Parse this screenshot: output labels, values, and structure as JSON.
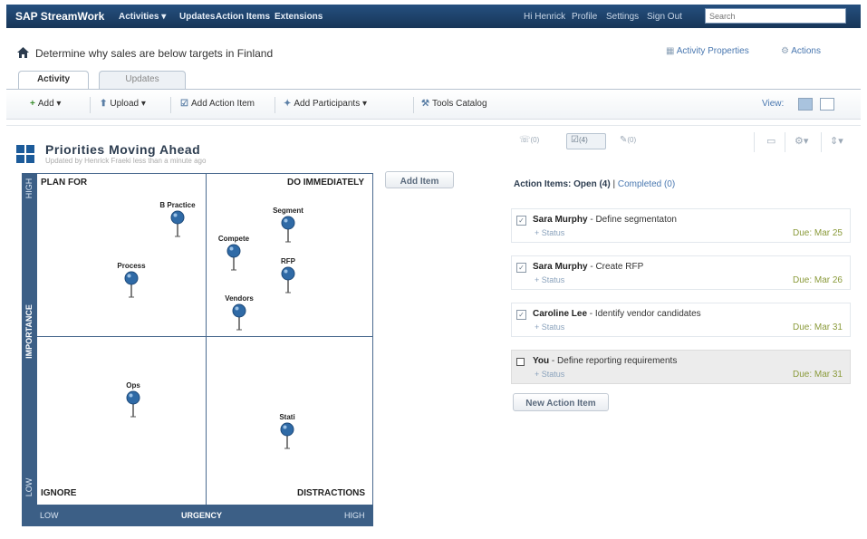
{
  "topnav": {
    "logo": "SAP StreamWork",
    "items": [
      "Activities ▾",
      "Updates",
      "Action Items",
      "Extensions"
    ],
    "right_links": [
      "Hi Henrick",
      "Profile",
      "Settings",
      "Sign Out"
    ],
    "search_placeholder": "Search"
  },
  "header": {
    "title": "Determine why sales are below targets in Finland",
    "activity_properties": "Activity Properties",
    "actions": "Actions"
  },
  "tabs": [
    {
      "label": "Activity",
      "active": true
    },
    {
      "label": "Updates",
      "active": false
    }
  ],
  "toolbar": {
    "add": "Add",
    "upload": "Upload",
    "add_action_item": "Add Action Item",
    "add_participants": "Add Participants",
    "tools_catalog": "Tools Catalog",
    "view_label": "View:"
  },
  "widget": {
    "title": "Priorities Moving Ahead",
    "subtitle": "Updated by Henrick Fraeki less than a minute ago",
    "add_item": "Add Item",
    "y_axis": {
      "label": "IMPORTANCE",
      "low": "LOW",
      "high": "HIGH"
    },
    "x_axis": {
      "label": "URGENCY",
      "low": "LOW",
      "high": "HIGH"
    },
    "quadrants": {
      "top_left": "PLAN FOR",
      "top_right": "DO IMMEDIATELY",
      "bottom_left": "IGNORE",
      "bottom_right": "DISTRACTIONS"
    },
    "pins": [
      {
        "label": "B Practice"
      },
      {
        "label": "Segment"
      },
      {
        "label": "Compete"
      },
      {
        "label": "Process"
      },
      {
        "label": "RFP"
      },
      {
        "label": "Vendors"
      },
      {
        "label": "Ops"
      },
      {
        "label": "Stati"
      }
    ]
  },
  "right_panel": {
    "tabs": [
      "(0)",
      "(4)",
      "(0)"
    ],
    "heading_open": "Action Items: Open (4)",
    "heading_completed": "Completed (0)",
    "items": [
      {
        "owner": "Sara Murphy",
        "task": " - Define segmentaton",
        "status": "+ Status",
        "due": "Due: Mar 25"
      },
      {
        "owner": "Sara Murphy",
        "task": " - Create RFP",
        "status": "+ Status",
        "due": "Due: Mar 26"
      },
      {
        "owner": "Caroline Lee",
        "task": " - Identify vendor candidates",
        "status": "+ Status",
        "due": "Due: Mar 31"
      },
      {
        "owner": "You",
        "task": " - Define reporting requirements",
        "status": "+ Status",
        "due": "Due: Mar 31"
      }
    ],
    "new_action_item": "New Action Item"
  },
  "colors": {
    "nav_bg": "#1d3f66",
    "axis_bg": "#3c5f86",
    "pin_blue": "#2f6aa6",
    "link": "#4a78b0",
    "due": "#8a9a3a"
  }
}
